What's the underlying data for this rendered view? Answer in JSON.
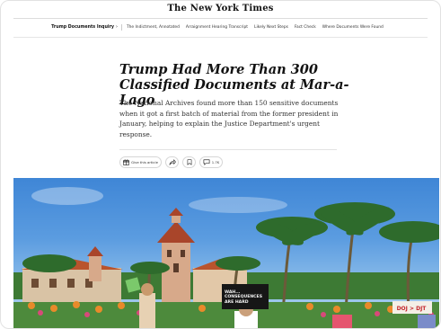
{
  "masthead": {
    "title": "The New York Times"
  },
  "nav": {
    "section": "Trump Documents Inquiry",
    "chevron": "›",
    "items": [
      "The Indictment, Annotated",
      "Arraignment Hearing Transcript",
      "Likely Next Steps",
      "Fact Check",
      "Where Documents Were Found"
    ]
  },
  "article": {
    "headline": "Trump Had More Than 300 Classified Documents at Mar-a-Lago",
    "summary": "The National Archives found more than 150 sensitive documents when it got a first batch of material from the former president in January, helping to explain the Justice Department's urgent response."
  },
  "toolbar": {
    "gift_label": "Give this article",
    "comments_count": "1.7K",
    "icons": [
      "gift-icon",
      "share-icon",
      "bookmark-icon",
      "comment-icon"
    ]
  },
  "photo": {
    "sign_left_text": "WAH... CONSEQUENCES ARE HARD",
    "sign_right_text": "DOJ > DJT"
  },
  "colors": {
    "text": "#121212",
    "secondary": "#333333",
    "border": "#dcdcdc"
  }
}
